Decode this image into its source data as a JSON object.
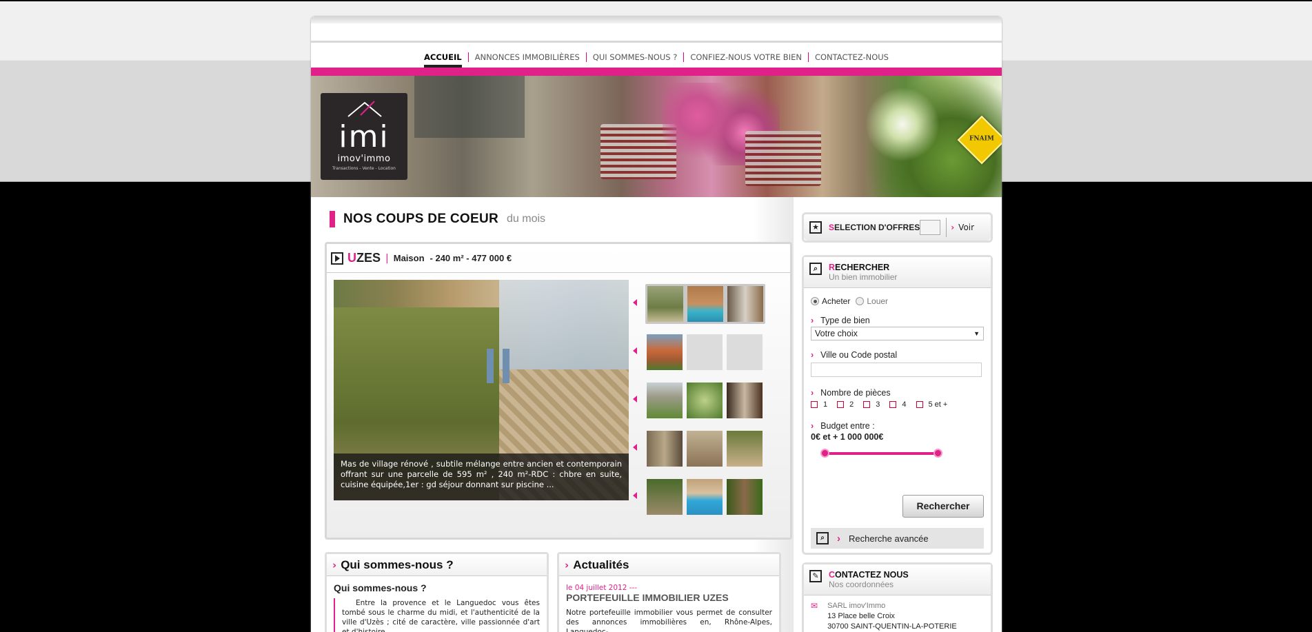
{
  "nav": {
    "items": [
      "ACCUEIL",
      "ANNONCES IMMOBILIÈRES",
      "QUI SOMMES-NOUS ?",
      "CONFIEZ-NOUS VOTRE BIEN",
      "CONTACTEZ-NOUS"
    ],
    "active": "ACCUEIL"
  },
  "logo": {
    "mark": "imi",
    "brand": "imov'immo",
    "tagline": "Transactions - Vente - Location"
  },
  "badge": "FNAIM",
  "featured": {
    "title": "NOS COUPS DE COEUR",
    "subtitle": "du mois",
    "city_initial": "U",
    "city_rest": "ZES",
    "separator": "|",
    "type": "Maison",
    "details": "- 240 m² - 477 000 €",
    "caption": "Mas de village rénové , subtile mélange entre ancien et contemporain offrant sur une parcelle de 595 m² , 240 m²-RDC : chbre en suite, cuisine équipée,1er : gd séjour donnant sur piscine ..."
  },
  "about": {
    "title": "Qui sommes-nous ?",
    "heading": "Qui sommes-nous ?",
    "text": "Entre la provence et le Languedoc vous êtes tombé sous le charme du midi, et l'authenticité de la ville d'Uzès ; cité de caractère, ville passionnée d'art et d'histoire ,"
  },
  "news": {
    "title": "Actualités",
    "date": "le 04 juillet 2012 ---",
    "headline": "PORTEFEUILLE IMMOBILIER UZES",
    "text": "Notre portefeuille immobilier vous permet de consulter des annonces immobilières en, Rhône-Alpes, Languedoc-"
  },
  "selection": {
    "label_initial": "S",
    "label_rest": "ELECTION D'OFFRES",
    "button": "Voir"
  },
  "search": {
    "title_initial": "R",
    "title_rest": "ECHERCHER",
    "subtitle": "Un bien immobilier",
    "radios": [
      "Acheter",
      "Louer"
    ],
    "type_label": "Type de bien",
    "type_value": "Votre choix",
    "city_label": "Ville ou Code postal",
    "pieces_label": "Nombre de pièces",
    "pieces": [
      "1",
      "2",
      "3",
      "4",
      "5 et +"
    ],
    "budget_label": "Budget entre :",
    "budget_value": "0€ et + 1 000 000€",
    "submit": "Rechercher",
    "advanced": "Recherche avancée"
  },
  "contact": {
    "title_initial": "C",
    "title_rest": "ONTACTEZ NOUS",
    "subtitle": "Nos coordonnées",
    "company": "SARL imov'Immo",
    "address": "13 Place belle Croix",
    "city": "30700 SAINT-QUENTIN-LA-POTERIE"
  },
  "colors": {
    "accent": "#e0218a",
    "dark": "#2b2728"
  }
}
